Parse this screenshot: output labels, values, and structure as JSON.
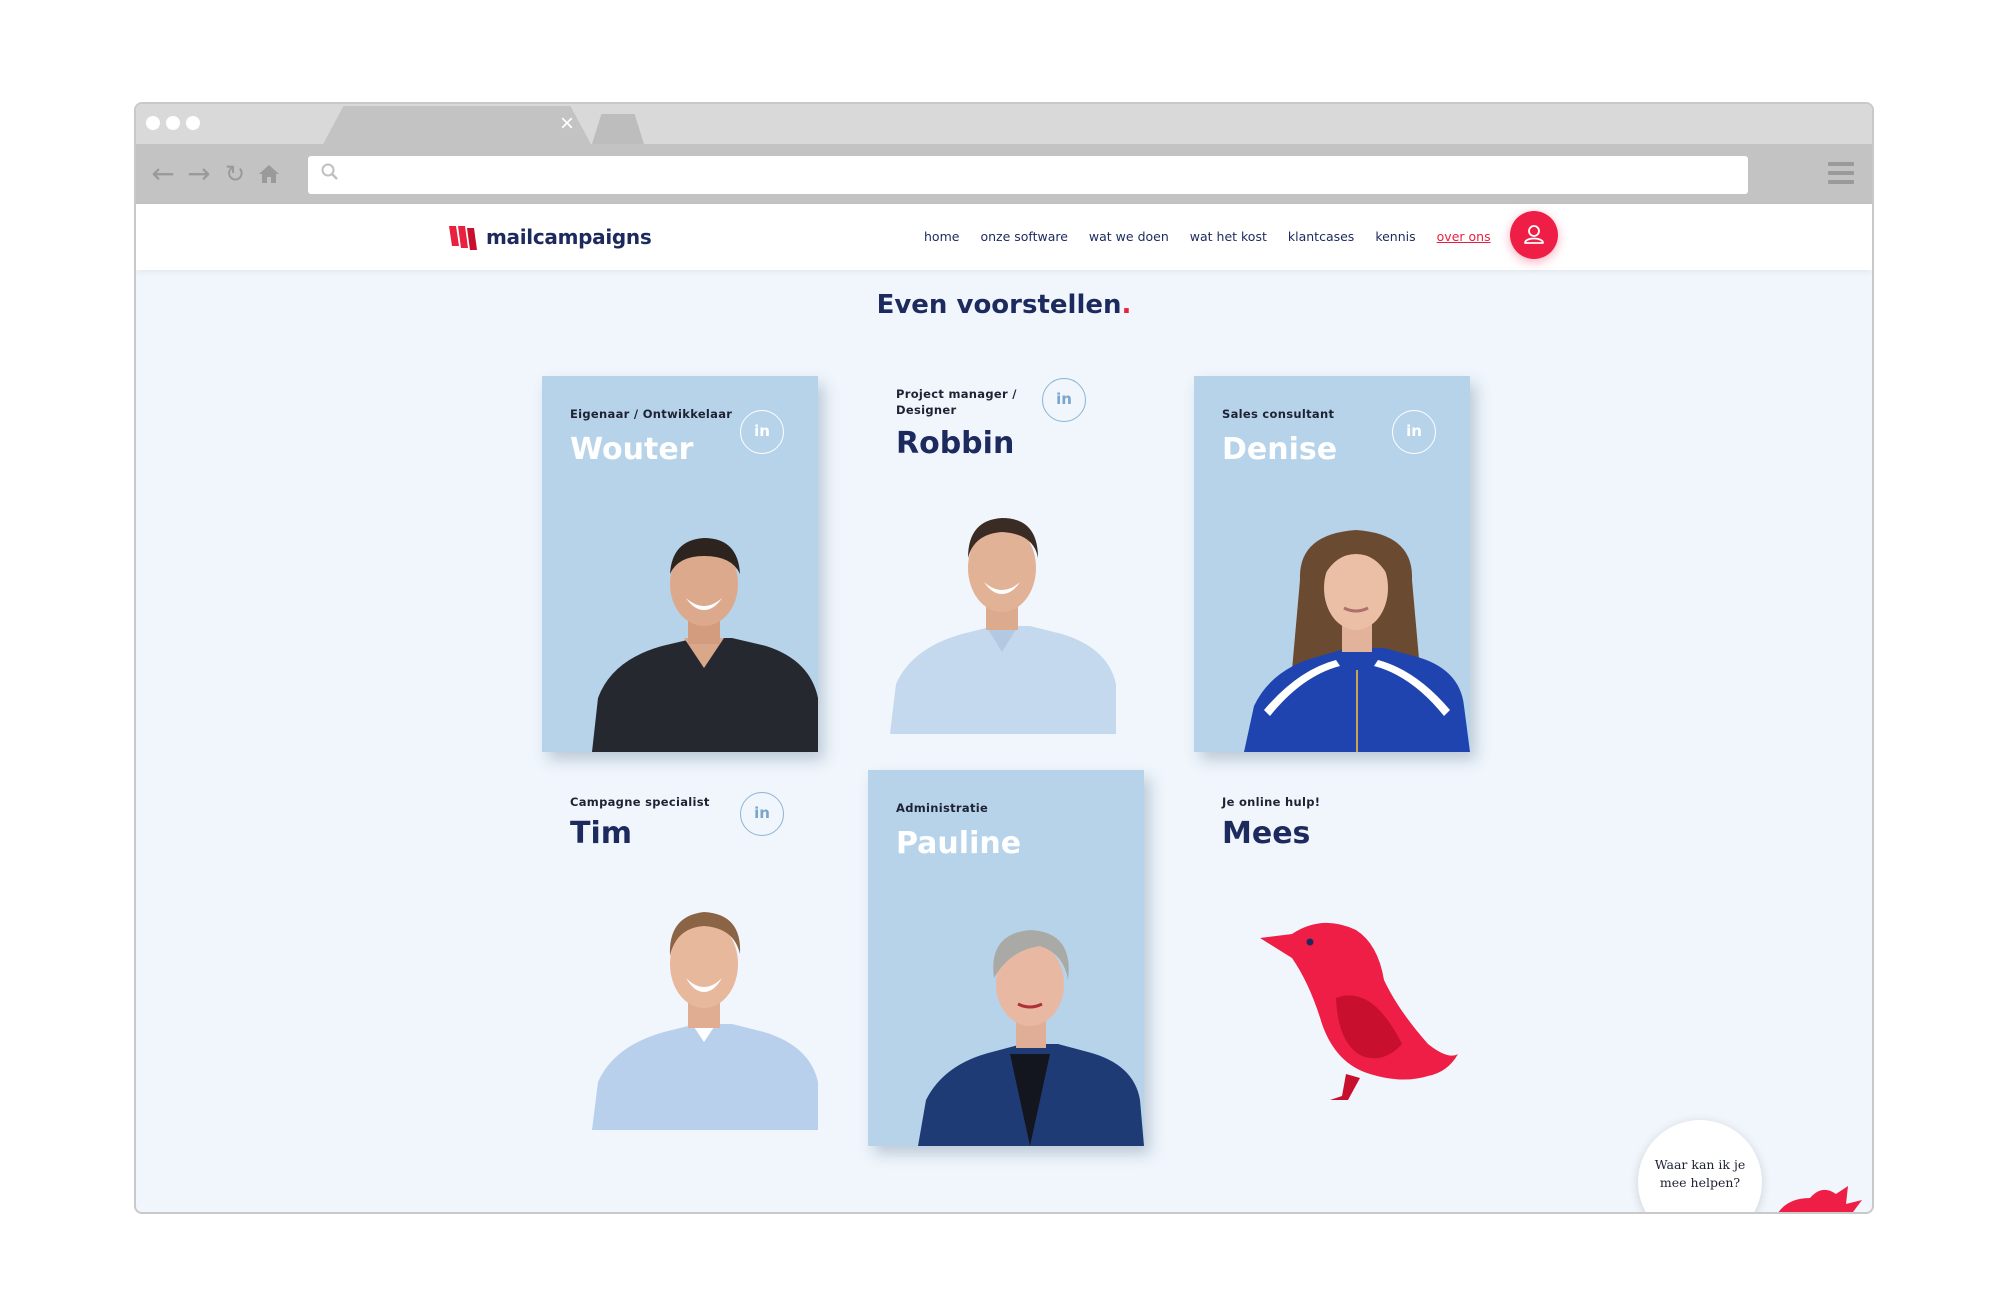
{
  "browser": {
    "tab_close": "×",
    "back_icon": "arrow-left-icon",
    "forward_icon": "arrow-right-icon",
    "reload_icon": "reload-icon",
    "home_icon": "home-icon",
    "url": ""
  },
  "site": {
    "logo_text": "mailcampaigns",
    "nav": [
      "home",
      "onze software",
      "wat we doen",
      "wat het kost",
      "klantcases",
      "kennis",
      "over ons"
    ],
    "active_nav": "over ons"
  },
  "page": {
    "title": "Even voorstellen",
    "title_dot": "."
  },
  "team": [
    {
      "role": "Eigenaar / Ontwikkelaar",
      "name": "Wouter",
      "linkedin": "in",
      "card_style": "filled"
    },
    {
      "role": "Project manager / Designer",
      "name": "Robbin",
      "linkedin": "in",
      "card_style": "plain"
    },
    {
      "role": "Sales consultant",
      "name": "Denise",
      "linkedin": "in",
      "card_style": "filled"
    },
    {
      "role": "Campagne specialist",
      "name": "Tim",
      "linkedin": "in",
      "card_style": "plain"
    },
    {
      "role": "Administratie",
      "name": "Pauline",
      "card_style": "filled"
    },
    {
      "role": "Je online hulp!",
      "name": "Mees",
      "card_style": "plain"
    }
  ],
  "chat": {
    "bubble_line1": "Waar kan ik je",
    "bubble_line2": "mee helpen?"
  },
  "colors": {
    "brand_navy": "#1c2a5e",
    "brand_red": "#ee1e46",
    "card_blue": "#b6d3ea",
    "page_bg": "#f0f6fc"
  }
}
